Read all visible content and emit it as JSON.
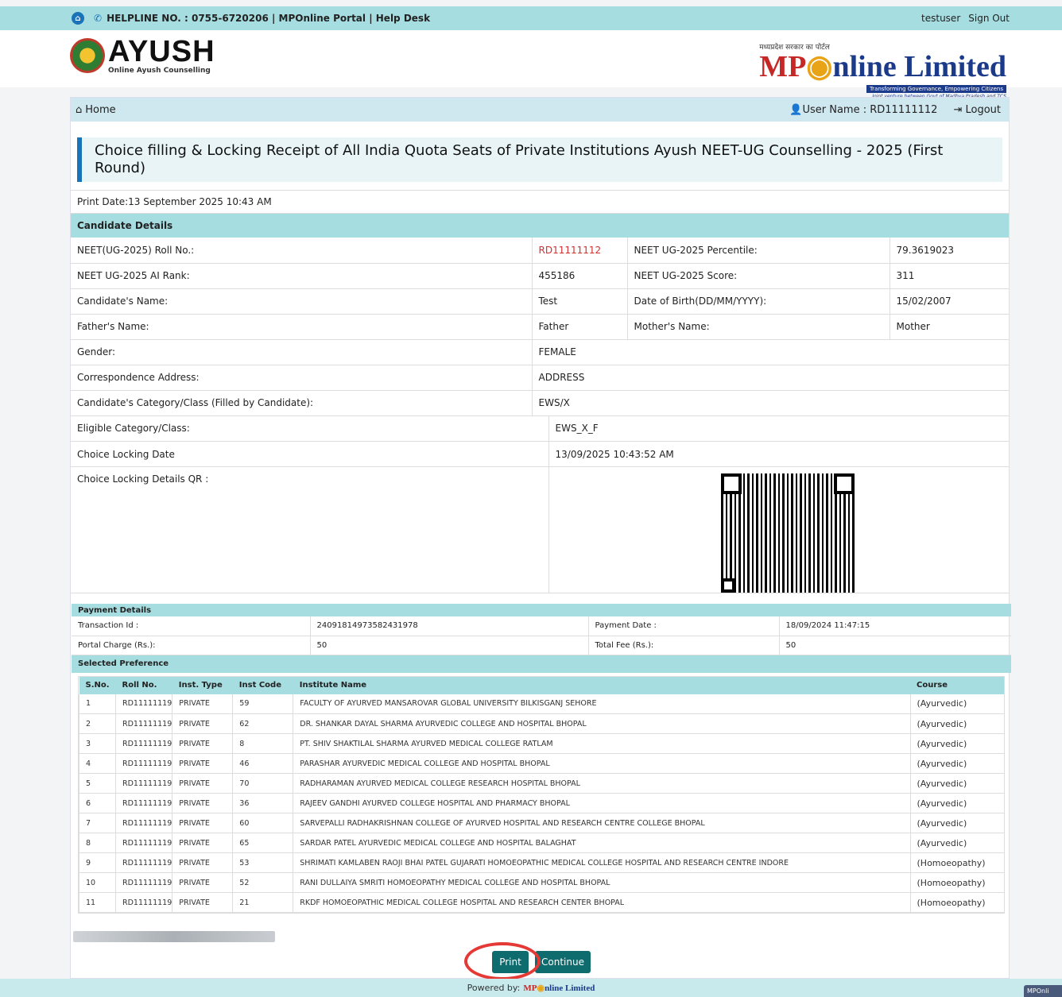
{
  "topbar": {
    "helpline": "HELPLINE NO. : 0755-6720206 |",
    "portal": "MPOnline Portal |",
    "helpdesk": "Help Desk",
    "user": "testuser",
    "signout": "Sign Out"
  },
  "header": {
    "ayush_title": "AYUSH",
    "ayush_sub": "Online Ayush Counselling",
    "mp_small": "मध्यप्रदेश सरकार का पोर्टल",
    "mp_title_a": "MP",
    "mp_title_b": "nline Limited",
    "mp_tag": "Transforming Governance, Empowering Citizens",
    "mp_tag2": "Joint venture between Govt of Madhya Pradesh and TCS"
  },
  "nav": {
    "home": "Home",
    "username": "User Name : RD11111112",
    "logout": "Logout"
  },
  "page_title": "Choice filling & Locking Receipt of All India Quota Seats of Private Institutions Ayush NEET-UG Counselling - 2025 (First Round)",
  "print_date": "Print Date:13 September 2025 10:43 AM",
  "candidate": {
    "heading": "Candidate Details",
    "roll_label": "NEET(UG-2025) Roll No.:",
    "roll_value": "RD11111112",
    "percentile_label": "NEET UG-2025 Percentile:",
    "percentile_value": "79.3619023",
    "rank_label": "NEET UG-2025 AI Rank:",
    "rank_value": "455186",
    "score_label": "NEET UG-2025 Score:",
    "score_value": "311",
    "name_label": "Candidate's Name:",
    "name_value": "Test",
    "dob_label": "Date of Birth(DD/MM/YYYY):",
    "dob_value": "15/02/2007",
    "father_label": "Father's Name:",
    "father_value": "Father",
    "mother_label": "Mother's Name:",
    "mother_value": "Mother",
    "gender_label": "Gender:",
    "gender_value": "FEMALE",
    "address_label": "Correspondence Address:",
    "address_value": "ADDRESS",
    "category_label": "Candidate's Category/Class (Filled by Candidate):",
    "category_value": "EWS/X",
    "eligible_label": "Eligible Category/Class:",
    "eligible_value": "EWS_X_F",
    "lockdate_label": "Choice Locking Date",
    "lockdate_value": "13/09/2025 10:43:52 AM",
    "qr_label": "Choice Locking Details QR :"
  },
  "payment": {
    "heading": "Payment Details",
    "txn_label": "Transaction Id :",
    "txn_value": "24091814973582431978",
    "paydate_label": "Payment Date :",
    "paydate_value": "18/09/2024 11:47:15",
    "portal_label": "Portal Charge (Rs.):",
    "portal_value": "50",
    "total_label": "Total Fee (Rs.):",
    "total_value": "50"
  },
  "preference": {
    "heading": "Selected Preference",
    "columns": [
      "S.No.",
      "Roll No.",
      "Inst. Type",
      "Inst Code",
      "Institute Name",
      "Course"
    ],
    "rows": [
      [
        "1",
        "RD11111119",
        "PRIVATE",
        "59",
        "FACULTY OF AYURVED MANSAROVAR GLOBAL UNIVERSITY BILKISGANJ SEHORE",
        "(Ayurvedic)"
      ],
      [
        "2",
        "RD11111119",
        "PRIVATE",
        "62",
        "DR. SHANKAR DAYAL SHARMA AYURVEDIC COLLEGE AND HOSPITAL BHOPAL",
        "(Ayurvedic)"
      ],
      [
        "3",
        "RD11111119",
        "PRIVATE",
        "8",
        "PT. SHIV SHAKTILAL SHARMA AYURVED MEDICAL COLLEGE RATLAM",
        "(Ayurvedic)"
      ],
      [
        "4",
        "RD11111119",
        "PRIVATE",
        "46",
        "PARASHAR AYURVEDIC MEDICAL COLLEGE AND HOSPITAL BHOPAL",
        "(Ayurvedic)"
      ],
      [
        "5",
        "RD11111119",
        "PRIVATE",
        "70",
        "RADHARAMAN AYURVED MEDICAL COLLEGE RESEARCH HOSPITAL BHOPAL",
        "(Ayurvedic)"
      ],
      [
        "6",
        "RD11111119",
        "PRIVATE",
        "36",
        "RAJEEV GANDHI AYURVED COLLEGE HOSPITAL AND PHARMACY BHOPAL",
        "(Ayurvedic)"
      ],
      [
        "7",
        "RD11111119",
        "PRIVATE",
        "60",
        "SARVEPALLI RADHAKRISHNAN COLLEGE OF AYURVED HOSPITAL AND RESEARCH CENTRE COLLEGE BHOPAL",
        "(Ayurvedic)"
      ],
      [
        "8",
        "RD11111119",
        "PRIVATE",
        "65",
        "SARDAR PATEL AYURVEDIC MEDICAL COLLEGE AND HOSPITAL BALAGHAT",
        "(Ayurvedic)"
      ],
      [
        "9",
        "RD11111119",
        "PRIVATE",
        "53",
        "SHRIMATI KAMLABEN RAOJI BHAI PATEL GUJARATI HOMOEOPATHIC MEDICAL COLLEGE HOSPITAL AND RESEARCH CENTRE INDORE",
        "(Homoeopathy)"
      ],
      [
        "10",
        "RD11111119",
        "PRIVATE",
        "52",
        "RANI DULLAIYA SMRITI HOMOEOPATHY MEDICAL COLLEGE AND HOSPITAL BHOPAL",
        "(Homoeopathy)"
      ],
      [
        "11",
        "RD11111119",
        "PRIVATE",
        "21",
        "RKDF HOMOEOPATHIC MEDICAL COLLEGE HOSPITAL AND RESEARCH CENTER BHOPAL",
        "(Homoeopathy)"
      ]
    ]
  },
  "buttons": {
    "print": "Print",
    "continue": "Continue"
  },
  "footer": {
    "powered": "Powered by:",
    "logo_a": "MP",
    "logo_b": "nline Limited"
  },
  "corner_badge": "MPOnli"
}
